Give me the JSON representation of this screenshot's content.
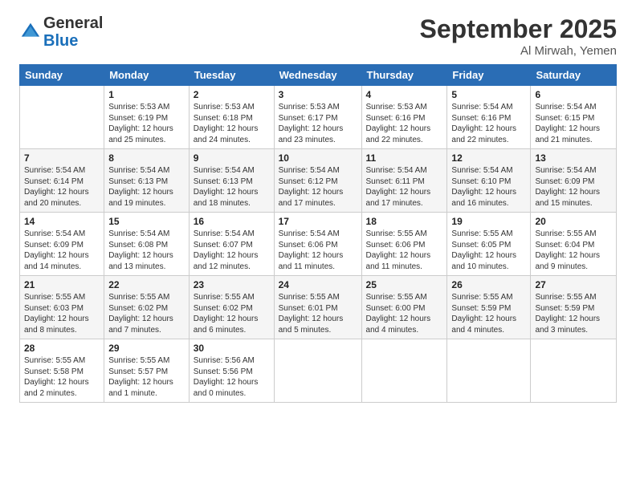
{
  "header": {
    "logo": {
      "general": "General",
      "blue": "Blue"
    },
    "title": "September 2025",
    "location": "Al Mirwah, Yemen"
  },
  "days_of_week": [
    "Sunday",
    "Monday",
    "Tuesday",
    "Wednesday",
    "Thursday",
    "Friday",
    "Saturday"
  ],
  "weeks": [
    [
      {
        "day": "",
        "info": ""
      },
      {
        "day": "1",
        "info": "Sunrise: 5:53 AM\nSunset: 6:19 PM\nDaylight: 12 hours\nand 25 minutes."
      },
      {
        "day": "2",
        "info": "Sunrise: 5:53 AM\nSunset: 6:18 PM\nDaylight: 12 hours\nand 24 minutes."
      },
      {
        "day": "3",
        "info": "Sunrise: 5:53 AM\nSunset: 6:17 PM\nDaylight: 12 hours\nand 23 minutes."
      },
      {
        "day": "4",
        "info": "Sunrise: 5:53 AM\nSunset: 6:16 PM\nDaylight: 12 hours\nand 22 minutes."
      },
      {
        "day": "5",
        "info": "Sunrise: 5:54 AM\nSunset: 6:16 PM\nDaylight: 12 hours\nand 22 minutes."
      },
      {
        "day": "6",
        "info": "Sunrise: 5:54 AM\nSunset: 6:15 PM\nDaylight: 12 hours\nand 21 minutes."
      }
    ],
    [
      {
        "day": "7",
        "info": "Sunrise: 5:54 AM\nSunset: 6:14 PM\nDaylight: 12 hours\nand 20 minutes."
      },
      {
        "day": "8",
        "info": "Sunrise: 5:54 AM\nSunset: 6:13 PM\nDaylight: 12 hours\nand 19 minutes."
      },
      {
        "day": "9",
        "info": "Sunrise: 5:54 AM\nSunset: 6:13 PM\nDaylight: 12 hours\nand 18 minutes."
      },
      {
        "day": "10",
        "info": "Sunrise: 5:54 AM\nSunset: 6:12 PM\nDaylight: 12 hours\nand 17 minutes."
      },
      {
        "day": "11",
        "info": "Sunrise: 5:54 AM\nSunset: 6:11 PM\nDaylight: 12 hours\nand 17 minutes."
      },
      {
        "day": "12",
        "info": "Sunrise: 5:54 AM\nSunset: 6:10 PM\nDaylight: 12 hours\nand 16 minutes."
      },
      {
        "day": "13",
        "info": "Sunrise: 5:54 AM\nSunset: 6:09 PM\nDaylight: 12 hours\nand 15 minutes."
      }
    ],
    [
      {
        "day": "14",
        "info": "Sunrise: 5:54 AM\nSunset: 6:09 PM\nDaylight: 12 hours\nand 14 minutes."
      },
      {
        "day": "15",
        "info": "Sunrise: 5:54 AM\nSunset: 6:08 PM\nDaylight: 12 hours\nand 13 minutes."
      },
      {
        "day": "16",
        "info": "Sunrise: 5:54 AM\nSunset: 6:07 PM\nDaylight: 12 hours\nand 12 minutes."
      },
      {
        "day": "17",
        "info": "Sunrise: 5:54 AM\nSunset: 6:06 PM\nDaylight: 12 hours\nand 11 minutes."
      },
      {
        "day": "18",
        "info": "Sunrise: 5:55 AM\nSunset: 6:06 PM\nDaylight: 12 hours\nand 11 minutes."
      },
      {
        "day": "19",
        "info": "Sunrise: 5:55 AM\nSunset: 6:05 PM\nDaylight: 12 hours\nand 10 minutes."
      },
      {
        "day": "20",
        "info": "Sunrise: 5:55 AM\nSunset: 6:04 PM\nDaylight: 12 hours\nand 9 minutes."
      }
    ],
    [
      {
        "day": "21",
        "info": "Sunrise: 5:55 AM\nSunset: 6:03 PM\nDaylight: 12 hours\nand 8 minutes."
      },
      {
        "day": "22",
        "info": "Sunrise: 5:55 AM\nSunset: 6:02 PM\nDaylight: 12 hours\nand 7 minutes."
      },
      {
        "day": "23",
        "info": "Sunrise: 5:55 AM\nSunset: 6:02 PM\nDaylight: 12 hours\nand 6 minutes."
      },
      {
        "day": "24",
        "info": "Sunrise: 5:55 AM\nSunset: 6:01 PM\nDaylight: 12 hours\nand 5 minutes."
      },
      {
        "day": "25",
        "info": "Sunrise: 5:55 AM\nSunset: 6:00 PM\nDaylight: 12 hours\nand 4 minutes."
      },
      {
        "day": "26",
        "info": "Sunrise: 5:55 AM\nSunset: 5:59 PM\nDaylight: 12 hours\nand 4 minutes."
      },
      {
        "day": "27",
        "info": "Sunrise: 5:55 AM\nSunset: 5:59 PM\nDaylight: 12 hours\nand 3 minutes."
      }
    ],
    [
      {
        "day": "28",
        "info": "Sunrise: 5:55 AM\nSunset: 5:58 PM\nDaylight: 12 hours\nand 2 minutes."
      },
      {
        "day": "29",
        "info": "Sunrise: 5:55 AM\nSunset: 5:57 PM\nDaylight: 12 hours\nand 1 minute."
      },
      {
        "day": "30",
        "info": "Sunrise: 5:56 AM\nSunset: 5:56 PM\nDaylight: 12 hours\nand 0 minutes."
      },
      {
        "day": "",
        "info": ""
      },
      {
        "day": "",
        "info": ""
      },
      {
        "day": "",
        "info": ""
      },
      {
        "day": "",
        "info": ""
      }
    ]
  ]
}
